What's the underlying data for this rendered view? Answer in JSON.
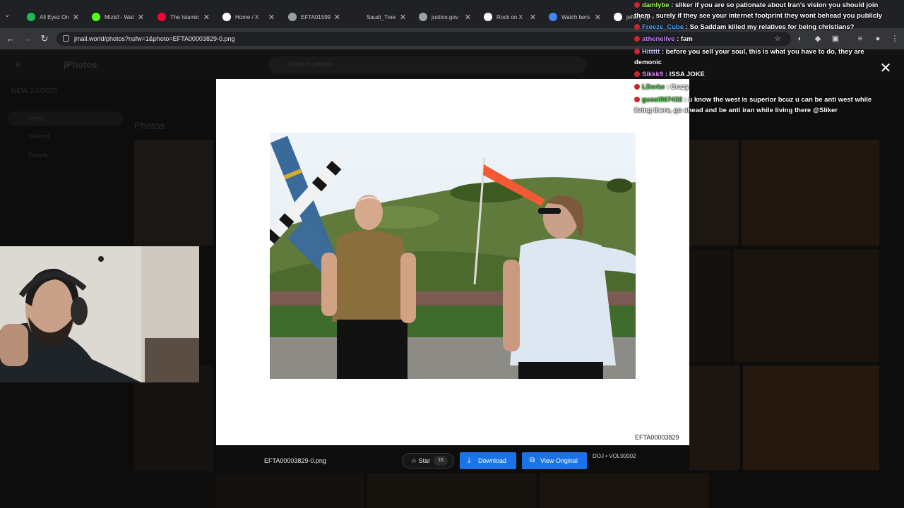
{
  "browser": {
    "tabs": [
      {
        "label": "All Eyez On",
        "icon": "spotify-icon",
        "color": "#1db954"
      },
      {
        "label": "Mizkif - Wat",
        "icon": "kick-icon",
        "color": "#53fc18"
      },
      {
        "label": "The Islamic",
        "icon": "youtube-icon",
        "color": "#ff0033"
      },
      {
        "label": "Home / X",
        "icon": "x-icon",
        "color": "#ffffff"
      },
      {
        "label": "EFTA01599",
        "icon": "globe-icon",
        "color": "#9aa0a6"
      },
      {
        "label": "Saudi_Tree",
        "icon": "blank-icon",
        "color": "#202124"
      },
      {
        "label": "justice.gov",
        "icon": "justice-icon",
        "color": "#9aa0a6"
      },
      {
        "label": "Rock on X",
        "icon": "x-icon",
        "color": "#ffffff"
      },
      {
        "label": "Watch bers",
        "icon": "stream-icon",
        "color": "#4285f4"
      },
      {
        "label": "jeffery epst",
        "icon": "google-icon",
        "color": "#ffffff"
      }
    ],
    "url": "jmail.world/photos?nsfw=1&photo=EFTA00003829-0.png"
  },
  "app": {
    "brand": "jPhotos",
    "search_placeholder": "Search photos",
    "notice": "NEW 2/2/2025",
    "side_items": [
      "Home",
      "Starred",
      "People"
    ],
    "section_title": "Photos"
  },
  "viewer": {
    "caption": "EFTA00003829",
    "filename": "EFTA00003829-0.png",
    "star_label": "Star",
    "star_count": "16",
    "download_label": "Download",
    "view_original_label": "View Original",
    "volume": "DOJ • VOL00002",
    "close_glyph": "✕"
  },
  "chat": {
    "messages": [
      {
        "user": "damlybe",
        "color": "#a8ff60",
        "text": " : sliker if you are so pationate about Iran's vision you should join them , surely if they see your internet footprint they wont behead you publicly"
      },
      {
        "user": "Freeze_Cube",
        "color": "#4aa8ff",
        "text": " : So Saddam killed my relatives for being christians?"
      },
      {
        "user": "athenelive",
        "color": "#c77dff",
        "text": " : fam"
      },
      {
        "user": "Hittttt",
        "color": "#c9c9ff",
        "text": " : before you sell your soul, this is what you have to do, they are demonic"
      },
      {
        "user": "Sikkk9",
        "color": "#e58cff",
        "text": " : ISSA JOKE"
      },
      {
        "user": "LDerke",
        "color": "#52d14a",
        "text": " : Crazy"
      },
      {
        "user": "guest567432",
        "color": "#52d14a",
        "text": " : u know the west is superior bcuz u can be anti west while living there, go ahead and be anti iran while living there @Sliker"
      }
    ]
  }
}
